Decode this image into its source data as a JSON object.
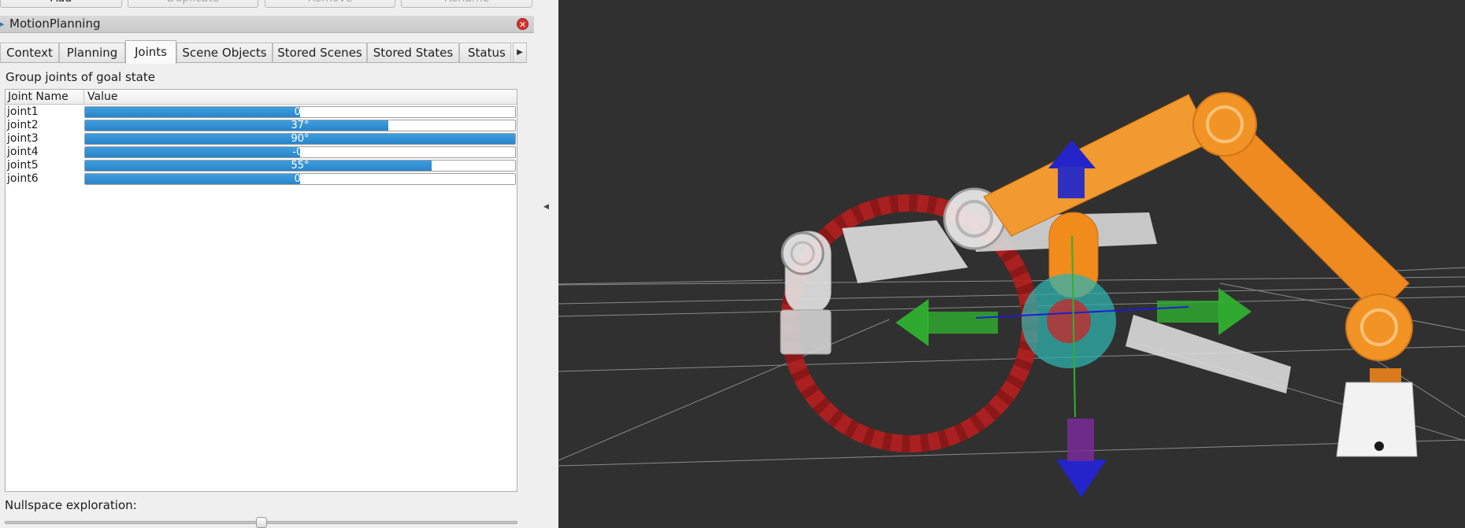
{
  "top_buttons": [
    {
      "label": "Add",
      "enabled": true
    },
    {
      "label": "Duplicate",
      "enabled": false
    },
    {
      "label": "Remove",
      "enabled": false
    },
    {
      "label": "Rename",
      "enabled": false
    }
  ],
  "dock": {
    "title": "MotionPlanning",
    "close_icon": "close-icon"
  },
  "tabs": [
    {
      "label": "Context"
    },
    {
      "label": "Planning"
    },
    {
      "label": "Joints",
      "active": true
    },
    {
      "label": "Scene Objects"
    },
    {
      "label": "Stored Scenes"
    },
    {
      "label": "Stored States"
    },
    {
      "label": "Status"
    }
  ],
  "joints_tab": {
    "group_label": "Group joints of goal state",
    "columns": [
      "Joint Name",
      "Value"
    ],
    "joints": [
      {
        "name": "joint1",
        "value": "0°",
        "fraction": 0.5
      },
      {
        "name": "joint2",
        "value": "37°",
        "fraction": 0.705
      },
      {
        "name": "joint3",
        "value": "90°",
        "fraction": 1.0
      },
      {
        "name": "joint4",
        "value": "-0°",
        "fraction": 0.5
      },
      {
        "name": "joint5",
        "value": "55°",
        "fraction": 0.805
      },
      {
        "name": "joint6",
        "value": "0°",
        "fraction": 0.5
      }
    ],
    "nullspace_label": "Nullspace exploration:",
    "nullspace_position": 0.5
  },
  "colors": {
    "accent": "#2a84c8",
    "viewport_bg": "#303030",
    "robot_orange": "#f08a1c",
    "robot_white": "#e8e8e8",
    "ring_red": "#c42525",
    "arrow_green": "#2fb02f",
    "arrow_blue": "#2424c8"
  },
  "icons": {
    "tab_scroll": "chevron-right-icon",
    "splitter": "chevron-left-icon",
    "dock_grip": "dock-grip-icon"
  }
}
